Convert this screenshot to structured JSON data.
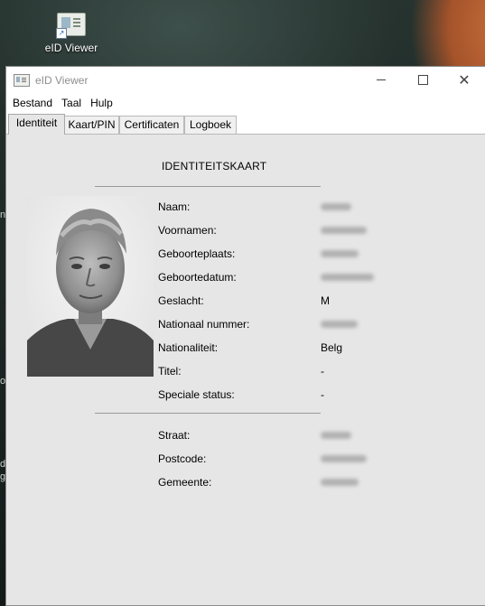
{
  "desktop": {
    "icon_label": "eID Viewer",
    "edge_chars": [
      "n",
      "o",
      "d",
      "g"
    ]
  },
  "window": {
    "title": "eID Viewer",
    "icon": "eid-viewer-icon",
    "controls": {
      "minimize": "minimize-icon",
      "maximize": "maximize-icon",
      "close": "close-icon"
    }
  },
  "menu": {
    "items": [
      {
        "label": "Bestand"
      },
      {
        "label": "Taal"
      },
      {
        "label": "Hulp"
      }
    ]
  },
  "tabs": [
    {
      "label": "Identiteit",
      "active": true
    },
    {
      "label": "Kaart/PIN",
      "active": false
    },
    {
      "label": "Certificaten",
      "active": false
    },
    {
      "label": "Logboek",
      "active": false
    }
  ],
  "card": {
    "heading": "IDENTITEITSKAART",
    "fields": [
      {
        "label": "Naam:",
        "value": "",
        "redacted": true
      },
      {
        "label": "Voornamen:",
        "value": "",
        "redacted": true
      },
      {
        "label": "Geboorteplaats:",
        "value": "",
        "redacted": true
      },
      {
        "label": "Geboortedatum:",
        "value": "",
        "redacted": true
      },
      {
        "label": "Geslacht:",
        "value": "M",
        "redacted": false
      },
      {
        "label": "Nationaal nummer:",
        "value": "",
        "redacted": true
      },
      {
        "label": "Nationaliteit:",
        "value": "Belg",
        "redacted": false
      },
      {
        "label": "Titel:",
        "value": "-",
        "redacted": false
      },
      {
        "label": "Speciale status:",
        "value": "-",
        "redacted": false
      }
    ],
    "address": [
      {
        "label": "Straat:",
        "value": "",
        "redacted": true
      },
      {
        "label": "Postcode:",
        "value": "",
        "redacted": true
      },
      {
        "label": "Gemeente:",
        "value": "",
        "redacted": true
      }
    ]
  }
}
